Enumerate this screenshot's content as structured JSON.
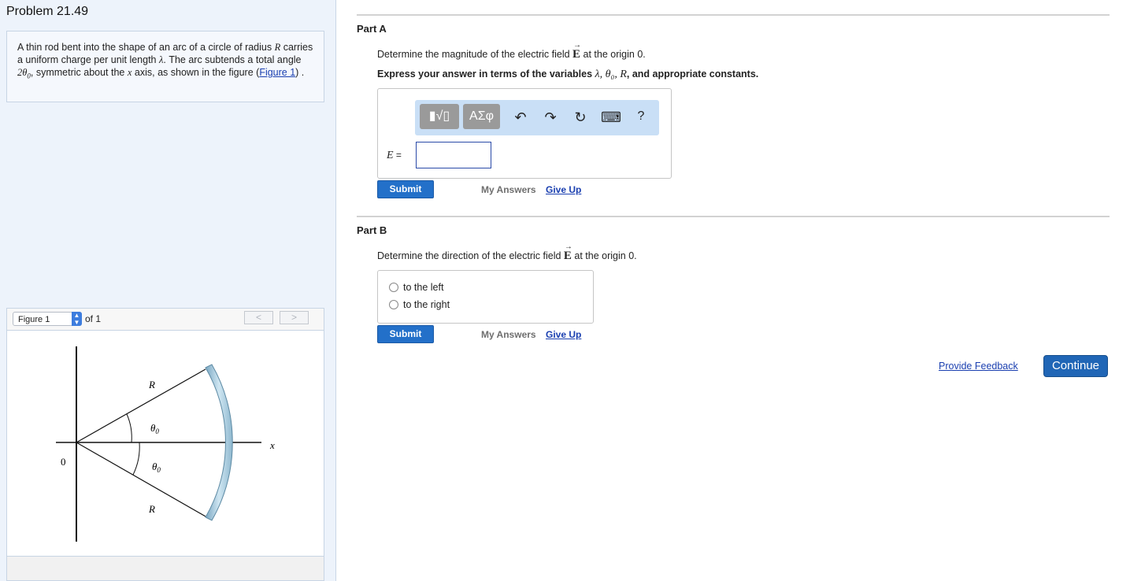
{
  "problem": {
    "title": "Problem 21.49",
    "text_1": "A thin rod bent into the shape of an arc of a circle of radius ",
    "var_R": "R",
    "text_2": " carries a uniform charge per unit length ",
    "var_lambda": "λ",
    "text_3": ". The arc subtends a total angle ",
    "var_angle": "2θ",
    "var_angle_sub": "0",
    "text_4": ", symmetric about the ",
    "var_x": "x",
    "text_5": " axis, as shown in the figure (",
    "figure_link": "Figure 1",
    "text_6": ") ."
  },
  "figure": {
    "select_value": "Figure 1",
    "of_text": "of 1",
    "prev_label": "<",
    "next_label": ">",
    "labels": {
      "R_top": "R",
      "theta_top": "θ",
      "theta_top_sub": "0",
      "origin": "0",
      "x_axis": "x",
      "theta_bottom": "θ",
      "theta_bottom_sub": "0",
      "R_bottom": "R"
    }
  },
  "partA": {
    "title": "Part A",
    "question_1": "Determine the magnitude of the electric field ",
    "field_symbol": "E",
    "question_2": " at the origin 0.",
    "instruction_1": "Express your answer in terms of the variables ",
    "instruction_vars": "λ, θ₀, R",
    "instruction_2": ", and appropriate constants.",
    "toolbar": {
      "template_btn": "▮√▯",
      "greek_btn": "ΑΣφ",
      "undo": "↶",
      "redo": "↷",
      "reset": "↻",
      "keyboard": "⌨",
      "help": "?"
    },
    "answer_label": "E",
    "answer_equals": " =",
    "answer_value": "",
    "submit": "Submit",
    "my_answers": "My Answers",
    "give_up": "Give Up"
  },
  "partB": {
    "title": "Part B",
    "question_1": "Determine the direction of the electric field ",
    "field_symbol": "E",
    "question_2": " at the origin 0.",
    "options": [
      "to the left",
      "to the right"
    ],
    "submit": "Submit",
    "my_answers": "My Answers",
    "give_up": "Give Up"
  },
  "footer": {
    "feedback": "Provide Feedback",
    "continue": "Continue"
  },
  "colors": {
    "accent": "#2370c9",
    "link": "#1a3fb0",
    "panel_bg": "#edf3fb",
    "arc": "#a9cde0"
  }
}
